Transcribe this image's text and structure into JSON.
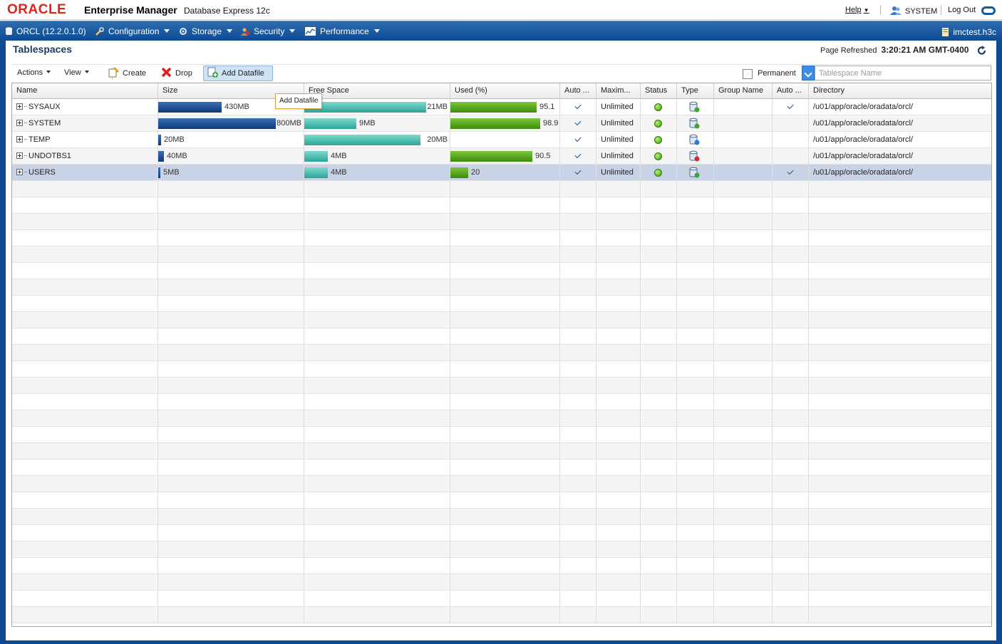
{
  "header": {
    "logo": "ORACLE",
    "app_name": "Enterprise Manager",
    "app_sub": "Database Express 12c",
    "help": "Help",
    "user": "SYSTEM",
    "logout": "Log Out"
  },
  "nav": {
    "db": "ORCL (12.2.0.1.0)",
    "configuration": "Configuration",
    "storage": "Storage",
    "security": "Security",
    "performance": "Performance",
    "host": "imctest.h3c"
  },
  "page": {
    "title": "Tablespaces",
    "refreshed_label": "Page Refreshed",
    "refreshed_time": "3:20:21 AM GMT-0400"
  },
  "toolbar": {
    "actions": "Actions",
    "view": "View",
    "create": "Create",
    "drop": "Drop",
    "add_datafile": "Add Datafile",
    "permanent_label": "Permanent",
    "search_placeholder": "Tablespace Name"
  },
  "tooltip": "Add Datafile",
  "columns": [
    "Name",
    "Size",
    "Free Space",
    "Used (%)",
    "Auto ...",
    "Maxim...",
    "Status",
    "Type",
    "Group Name",
    "Auto ...",
    "Directory"
  ],
  "rows": [
    {
      "name": "SYSAUX",
      "size": "430MB",
      "size_mb": 430,
      "free": "21MB",
      "free_mb": 21,
      "used": "95.1",
      "used_pct": 95.1,
      "auto_extend": true,
      "max": "Unlimited",
      "status": "online",
      "type": "permanent",
      "group": "",
      "auto2": true,
      "directory": "/u01/app/oracle/oradata/orcl/"
    },
    {
      "name": "SYSTEM",
      "size": "800MB",
      "size_mb": 800,
      "free": "9MB",
      "free_mb": 9,
      "used": "98.9",
      "used_pct": 98.9,
      "auto_extend": true,
      "max": "Unlimited",
      "status": "online",
      "type": "permanent",
      "group": "",
      "auto2": false,
      "directory": "/u01/app/oracle/oradata/orcl/"
    },
    {
      "name": "TEMP",
      "size": "20MB",
      "size_mb": 20,
      "free": "20MB",
      "free_mb": 20,
      "used": "",
      "used_pct": 0,
      "auto_extend": true,
      "max": "Unlimited",
      "status": "online",
      "type": "temporary",
      "group": "",
      "auto2": false,
      "directory": "/u01/app/oracle/oradata/orcl/"
    },
    {
      "name": "UNDOTBS1",
      "size": "40MB",
      "size_mb": 40,
      "free": "4MB",
      "free_mb": 4,
      "used": "90.5",
      "used_pct": 90.5,
      "auto_extend": true,
      "max": "Unlimited",
      "status": "online",
      "type": "undo",
      "group": "",
      "auto2": false,
      "directory": "/u01/app/oracle/oradata/orcl/"
    },
    {
      "name": "USERS",
      "size": "5MB",
      "size_mb": 5,
      "free": "4MB",
      "free_mb": 4,
      "used": "20",
      "used_pct": 20,
      "auto_extend": true,
      "max": "Unlimited",
      "status": "online",
      "type": "permanent",
      "group": "",
      "auto2": true,
      "directory": "/u01/app/oracle/oradata/orcl/"
    }
  ],
  "selected_row": 4,
  "colors": {
    "brand_red": "#e2231a",
    "nav_blue": "#0e4b93",
    "size_bar": "#1a4d90",
    "free_bar": "#4fc0b2",
    "used_bar": "#5ea820",
    "status_online": "#3a9a10"
  }
}
